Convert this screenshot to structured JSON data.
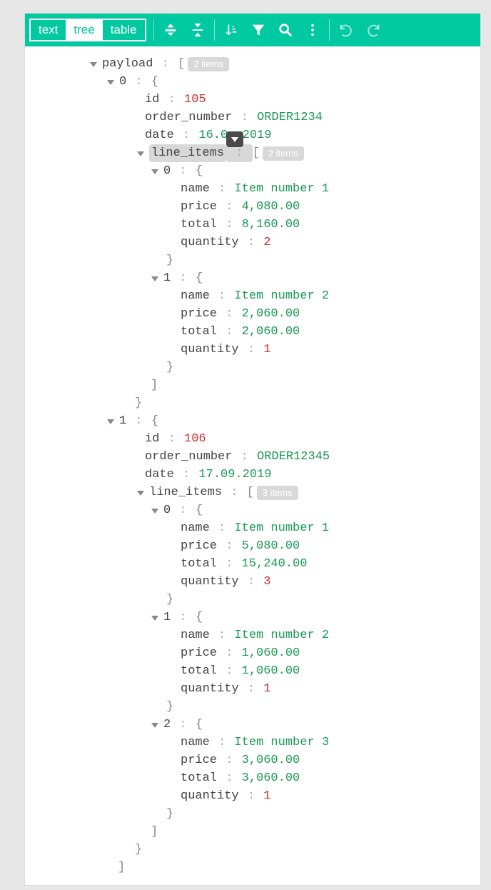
{
  "toolbar": {
    "tabs": {
      "text": "text",
      "tree": "tree",
      "table": "table"
    }
  },
  "tree": {
    "payload_key": "payload",
    "payload_badge": "2 items",
    "item0": {
      "index": "0",
      "id_key": "id",
      "id_val": "105",
      "ordernum_key": "order_number",
      "ordernum_val": "ORDER1234",
      "date_key": "date",
      "date_val_a": "16.0",
      "date_val_b": ".2019",
      "lineitems_key": "line_items",
      "lineitems_badge": "2 items",
      "li0": {
        "index": "0",
        "name_key": "name",
        "name_val": "Item number 1",
        "price_key": "price",
        "price_val": "4,080.00",
        "total_key": "total",
        "total_val": "8,160.00",
        "qty_key": "quantity",
        "qty_val": "2"
      },
      "li1": {
        "index": "1",
        "name_key": "name",
        "name_val": "Item number 2",
        "price_key": "price",
        "price_val": "2,060.00",
        "total_key": "total",
        "total_val": "2,060.00",
        "qty_key": "quantity",
        "qty_val": "1"
      }
    },
    "item1": {
      "index": "1",
      "id_key": "id",
      "id_val": "106",
      "ordernum_key": "order_number",
      "ordernum_val": "ORDER12345",
      "date_key": "date",
      "date_val": "17.09.2019",
      "lineitems_key": "line_items",
      "lineitems_badge": "3 items",
      "li0": {
        "index": "0",
        "name_key": "name",
        "name_val": "Item number 1",
        "price_key": "price",
        "price_val": "5,080.00",
        "total_key": "total",
        "total_val": "15,240.00",
        "qty_key": "quantity",
        "qty_val": "3"
      },
      "li1": {
        "index": "1",
        "name_key": "name",
        "name_val": "Item number 2",
        "price_key": "price",
        "price_val": "1,060.00",
        "total_key": "total",
        "total_val": "1,060.00",
        "qty_key": "quantity",
        "qty_val": "1"
      },
      "li2": {
        "index": "2",
        "name_key": "name",
        "name_val": "Item number 3",
        "price_key": "price",
        "price_val": "3,060.00",
        "total_key": "total",
        "total_val": "3,060.00",
        "qty_key": "quantity",
        "qty_val": "1"
      }
    }
  }
}
